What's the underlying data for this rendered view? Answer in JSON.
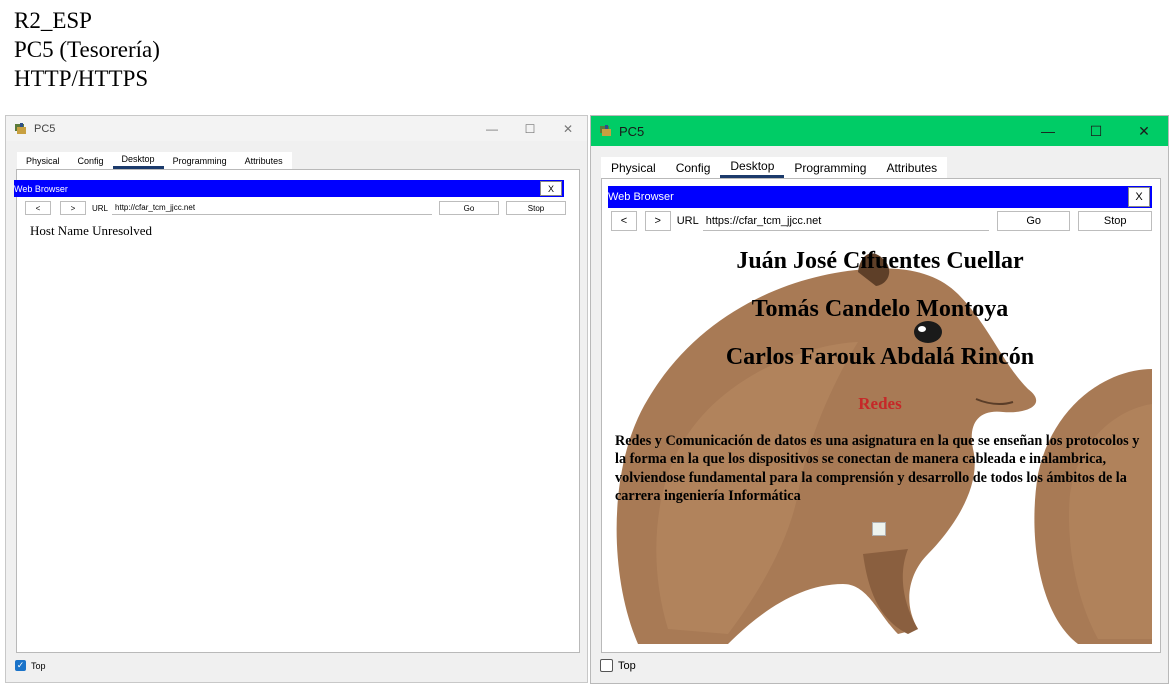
{
  "doc": {
    "line1": "R2_ESP",
    "line2": "PC5 (Tesorería)",
    "line3": "HTTP/HTTPS"
  },
  "left_window": {
    "title": "PC5",
    "controls": {
      "minimize": "—",
      "maximize": "☐",
      "close": "✕"
    },
    "tabs": [
      "Physical",
      "Config",
      "Desktop",
      "Programming",
      "Attributes"
    ],
    "active_tab": "Desktop",
    "browser": {
      "header": "Web Browser",
      "close": "X",
      "back": "<",
      "forward": ">",
      "url_label": "URL",
      "url": "http://cfar_tcm_jjcc.net",
      "go": "Go",
      "stop": "Stop",
      "message": "Host Name Unresolved"
    },
    "top_label": "Top",
    "top_checked": true
  },
  "right_window": {
    "title": "PC5",
    "titlebar_color": "#00cc66",
    "controls": {
      "minimize": "—",
      "maximize": "☐",
      "close": "✕"
    },
    "tabs": [
      "Physical",
      "Config",
      "Desktop",
      "Programming",
      "Attributes"
    ],
    "active_tab": "Desktop",
    "browser": {
      "header": "Web Browser",
      "close": "X",
      "back": "<",
      "forward": ">",
      "url_label": "URL",
      "url": "https://cfar_tcm_jjcc.net",
      "go": "Go",
      "stop": "Stop"
    },
    "page": {
      "name1": "Juán José Cifuentes Cuellar",
      "name2": "Tomás Candelo Montoya",
      "name3": "Carlos Farouk Abdalá Rincón",
      "subject": "Redes",
      "subject_color": "#c62828",
      "paragraph": "Redes y Comunicación de datos es una asignatura en la que se enseñan los protocolos y la forma en la que los dispositivos se conectan de manera cableada e inalambrica, volviendose fundamental para la comprensión y desarrollo de todos los ámbitos de la carrera ingeniería Informática",
      "background_image": "capybara"
    },
    "top_label": "Top",
    "top_checked": false
  }
}
